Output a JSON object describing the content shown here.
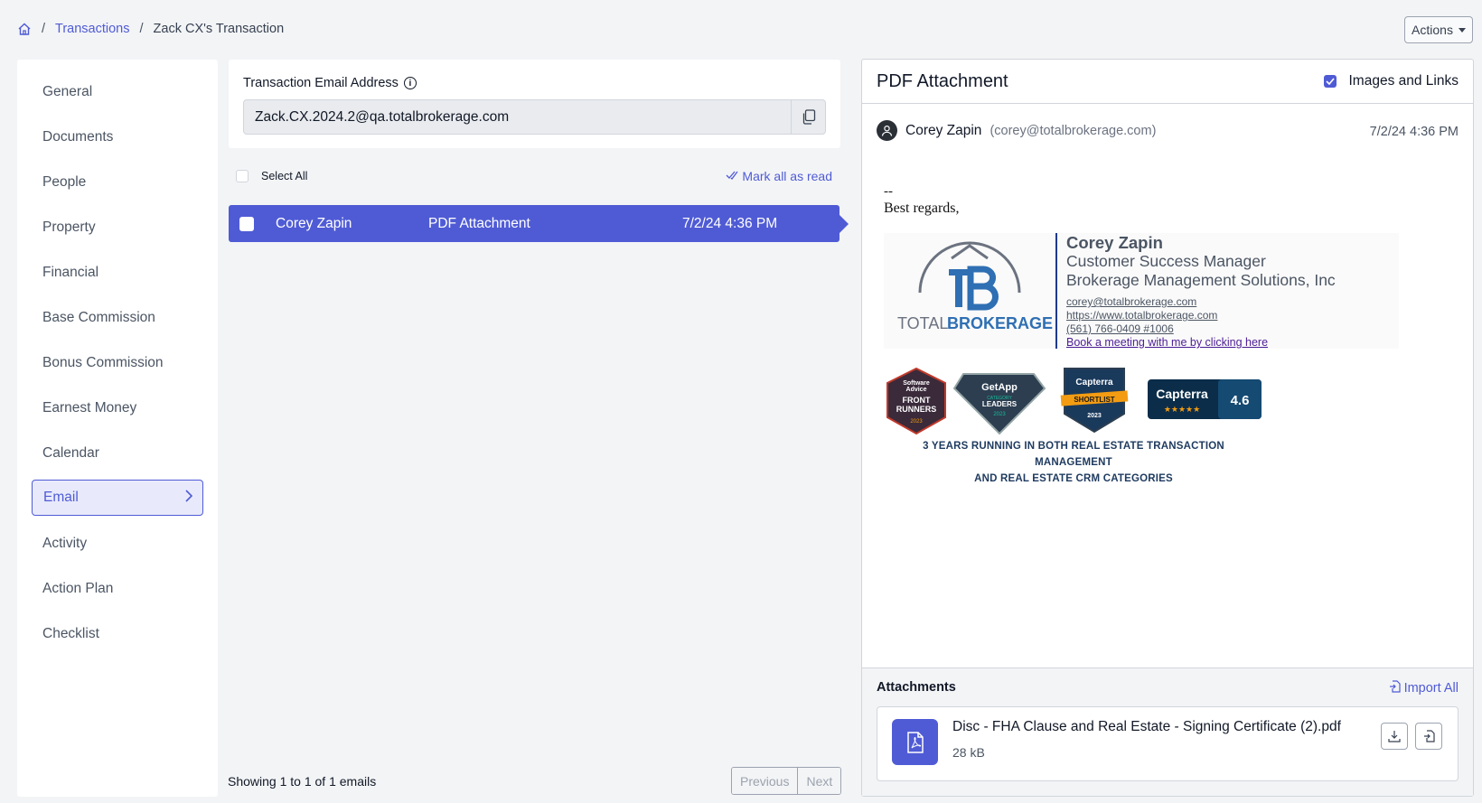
{
  "breadcrumb": {
    "home_icon": "home-icon",
    "transactions": "Transactions",
    "separator": "/",
    "current": "Zack CX's Transaction"
  },
  "actions_label": "Actions",
  "sidebar": {
    "items": [
      {
        "label": "General"
      },
      {
        "label": "Documents"
      },
      {
        "label": "People"
      },
      {
        "label": "Property"
      },
      {
        "label": "Financial"
      },
      {
        "label": "Base Commission"
      },
      {
        "label": "Bonus Commission"
      },
      {
        "label": "Earnest Money"
      },
      {
        "label": "Calendar"
      },
      {
        "label": "Email",
        "active": true
      },
      {
        "label": "Activity"
      },
      {
        "label": "Action Plan"
      },
      {
        "label": "Checklist"
      }
    ]
  },
  "transaction_email": {
    "label": "Transaction Email Address",
    "value": "Zack.CX.2024.2@qa.totalbrokerage.com"
  },
  "list": {
    "select_all": "Select All",
    "mark_all_read": "Mark all as read",
    "messages": [
      {
        "from": "Corey Zapin",
        "subject": "PDF Attachment",
        "date": "7/2/24 4:36 PM",
        "selected": true
      }
    ],
    "showing": "Showing 1 to 1 of 1 emails",
    "previous": "Previous",
    "next": "Next"
  },
  "detail": {
    "title": "PDF Attachment",
    "images_and_links": "Images and Links",
    "images_and_links_checked": true,
    "sender_name": "Corey Zapin",
    "sender_email": "(corey@totalbrokerage.com)",
    "date": "7/2/24 4:36 PM",
    "body_separator": "--",
    "body_regards": "Best regards,",
    "signature": {
      "logo_text_1": "TOTAL",
      "logo_text_2": "BROKERAGE",
      "name": "Corey Zapin",
      "role": "Customer Success Manager",
      "company": "Brokerage Management Solutions, Inc",
      "email": "corey@totalbrokerage.com",
      "website": "https://www.totalbrokerage.com",
      "phone": "(561) 766-0409 #1006",
      "meeting": "Book a meeting with me by clicking here"
    },
    "badges": {
      "b1_line1": "Software",
      "b1_line2": "Advice",
      "b1_line3": "FRONT",
      "b1_line4": "RUNNERS",
      "b1_year": "2023",
      "b2_line1": "GetApp",
      "b2_line2": "CATEGORY",
      "b2_line3": "LEADERS",
      "b2_year": "2023",
      "b3_line1": "Capterra",
      "b3_line2": "SHORTLIST",
      "b3_year": "2023",
      "b4_name": "Capterra",
      "b4_rating": "4.6",
      "caption_line1": "3 YEARS RUNNING IN BOTH REAL ESTATE TRANSACTION MANAGEMENT",
      "caption_line2": "AND REAL ESTATE CRM CATEGORIES"
    },
    "attachments": {
      "title": "Attachments",
      "import_all": "Import All",
      "files": [
        {
          "name": "Disc - FHA Clause and Real Estate - Signing Certificate (2).pdf",
          "size": "28 kB",
          "icon": "pdf-file-icon"
        }
      ]
    }
  },
  "colors": {
    "accent": "#4f5bd5",
    "background": "#f3f4f6"
  }
}
